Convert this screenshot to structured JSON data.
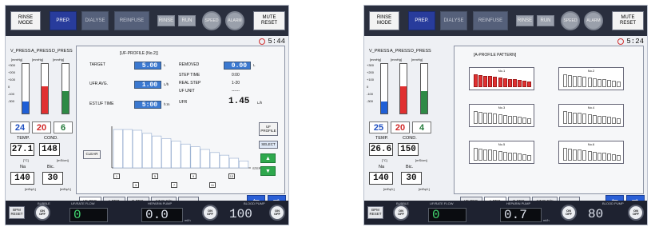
{
  "screens": [
    {
      "topbar": {
        "rinse_mode": "RINSE\nMODE",
        "prep": "PREP.",
        "dialyse": "DIALYSE",
        "reinfuse": "REINFUSE",
        "btn_a": "RINSE",
        "btn_b": "RUN",
        "circ_a": "SPEED",
        "circ_b": "ALARM",
        "mute": "MUTE\nRESET"
      },
      "clock": "5:44",
      "pressures": {
        "labels": [
          "V_PRESS",
          "A_PRESS",
          "D_PRESS"
        ],
        "unit": "[mmHg]",
        "values": [
          "24",
          "20",
          "6"
        ],
        "levels": [
          0.25,
          0.55,
          0.45
        ],
        "colors": [
          "#1f5fd6",
          "#e03030",
          "#2e8a45"
        ],
        "scale_left": [
          "+300",
          "+200",
          "+100",
          "0",
          "-100",
          "-300"
        ]
      },
      "temp": {
        "label": "TEMP.",
        "value": "27.1",
        "unit": "[°C]"
      },
      "cond": {
        "label": "COND.",
        "value": "148",
        "unit": "[mS/cm]"
      },
      "na": {
        "label": "Na",
        "value": "140",
        "unit": "[mEq/L]"
      },
      "bic": {
        "label": "Bic.",
        "value": "30",
        "unit": "[mEq/L]"
      },
      "profile": {
        "title": "[UF-PROFILE",
        "number": "(No.2)]",
        "target_label": "TARGET",
        "target_value": "5.00",
        "target_unit": "L",
        "ufr_label": "UFR AVG.",
        "ufr_value": "1.00",
        "ufr_unit": "L/h",
        "est_label": "EST.UF TIME",
        "est_value": "5:00",
        "est_unit": "h:m",
        "removed_label": "REMOVED",
        "removed_value": "0.00",
        "removed_unit": "L",
        "step_time_label": "STEP TIME",
        "step_time_value": "0:00",
        "real_step_label": "REAL STEP",
        "real_step_value": "1-20",
        "uf_unit_label": "UF UNIT",
        "uf_unit_value": "------",
        "ufr_label2": "UFR",
        "ufr_value2": "1.45",
        "ufr_unit2": "L/h",
        "clear": "CLEAR",
        "step": "STEP",
        "select": "SELECT",
        "uf_btn": "UF\nPROFILE",
        "steps": [
          "1",
          "3",
          "5",
          "7",
          "9",
          "11",
          "13"
        ],
        "profile_values": [
          1.0,
          1.0,
          0.98,
          0.9,
          0.83,
          0.76,
          0.7,
          0.62,
          0.55,
          0.48,
          0.4,
          0.33,
          0.25,
          0.18
        ]
      },
      "tabs": [
        "UF-PRO.",
        "A-PRO.",
        "B-PRO.",
        "SINGLE/N",
        "- -"
      ],
      "bottombar": {
        "bpm_label": "BPM\nRESET",
        "bubble_label": "BUBBLE",
        "uf_flow_label": "UF/RATE FLOW",
        "uf_flow_value": "0",
        "heparin_label": "HEPARIN PUMP",
        "heparin_value": "0.0",
        "heparin_unit": "ml/h",
        "blood_label": "BLOOD PUMP",
        "blood_value": "100",
        "blood_unit": "ml/min",
        "onoff": "ON\nOFF"
      }
    },
    {
      "topbar": {
        "rinse_mode": "RINSE\nMODE",
        "prep": "PREP.",
        "dialyse": "DIALYSE",
        "reinfuse": "REINFUSE",
        "btn_a": "RINSE",
        "btn_b": "RUN",
        "circ_a": "SPEED",
        "circ_b": "ALARM",
        "mute": "MUTE\nRESET"
      },
      "clock": "5:24",
      "pressures": {
        "labels": [
          "V_PRESS",
          "A_PRESS",
          "D_PRESS"
        ],
        "unit": "[mmHg]",
        "values": [
          "25",
          "20",
          "4"
        ],
        "levels": [
          0.25,
          0.55,
          0.45
        ],
        "colors": [
          "#1f5fd6",
          "#e03030",
          "#2e8a45"
        ],
        "scale_left": [
          "+300",
          "+200",
          "+100",
          "0",
          "-100",
          "-300"
        ]
      },
      "temp": {
        "label": "TEMP.",
        "value": "26.6",
        "unit": "[°C]"
      },
      "cond": {
        "label": "COND.",
        "value": "150",
        "unit": "[mS/cm]"
      },
      "na": {
        "label": "Na",
        "value": "140",
        "unit": "[mEq/L]"
      },
      "bic": {
        "label": "Bic.",
        "value": "30",
        "unit": "[mEq/L]"
      },
      "patterns": {
        "title": "[A-PROFILE PATTERN]",
        "items": [
          {
            "label": "No.1",
            "selected": true
          },
          {
            "label": "No.2",
            "selected": false
          },
          {
            "label": "No.3",
            "selected": false
          },
          {
            "label": "No.4",
            "selected": false
          },
          {
            "label": "No.5",
            "selected": false
          },
          {
            "label": "No.6",
            "selected": false
          }
        ]
      },
      "tabs": [
        "UF-PRO.",
        "A-PRO.",
        "B-PRO.",
        "SINGLE/N",
        "- -"
      ],
      "bottombar": {
        "bpm_label": "BPM\nRESET",
        "bubble_label": "BUBBLE",
        "uf_flow_label": "UF/RATE FLOW",
        "uf_flow_value": "0",
        "heparin_label": "HEPARIN PUMP",
        "heparin_value": "0.7",
        "heparin_unit": "ml/h",
        "blood_label": "BLOOD PUMP",
        "blood_value": "80",
        "blood_unit": "ml/min",
        "onoff": "ON\nOFF"
      }
    }
  ]
}
